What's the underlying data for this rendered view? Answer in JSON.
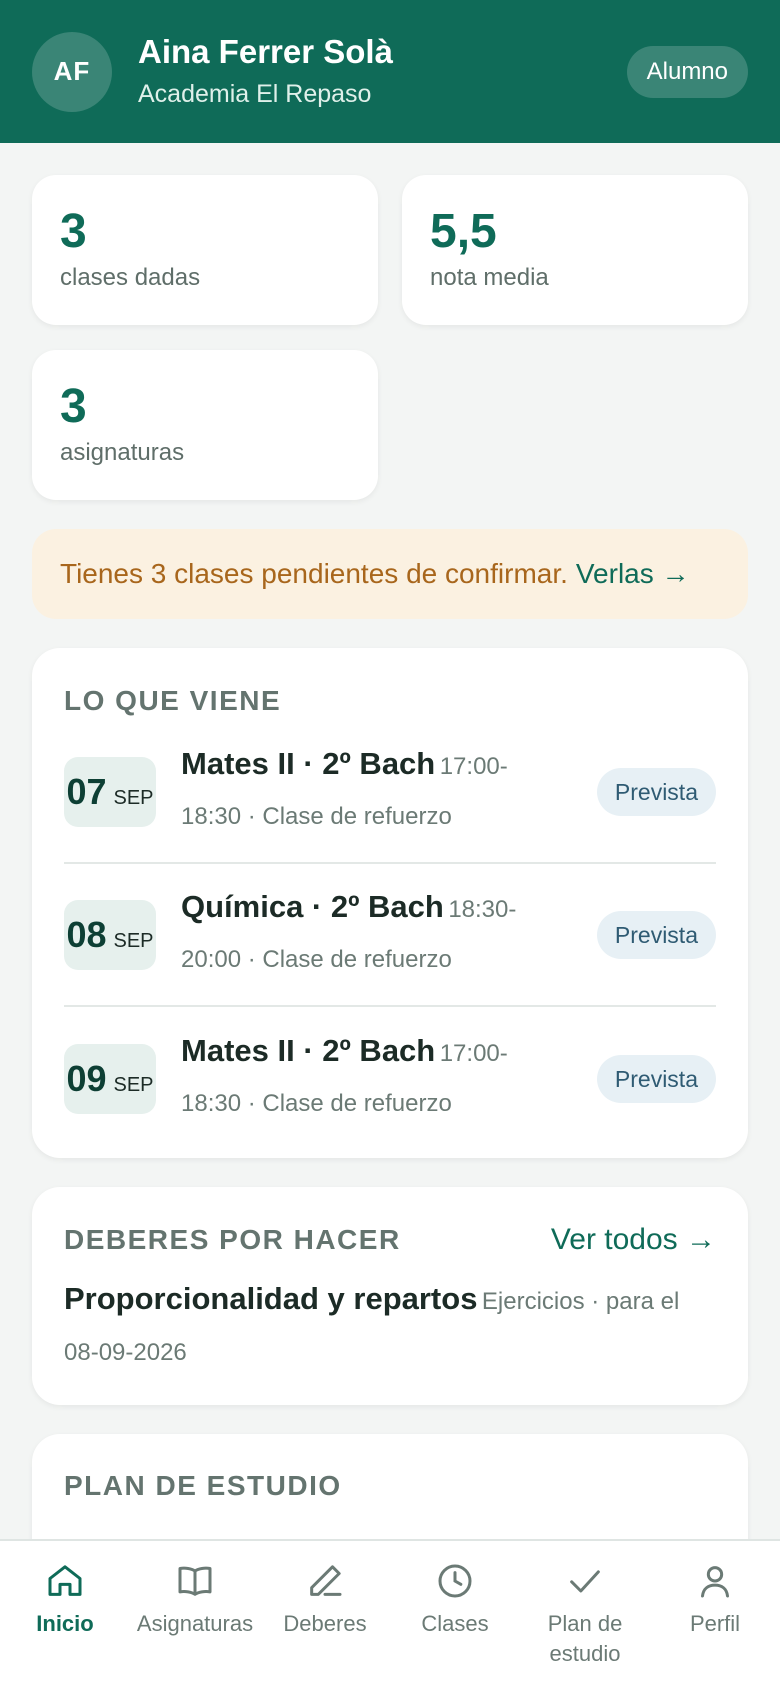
{
  "header": {
    "initials": "AF",
    "name": "Aina Ferrer Solà",
    "school": "Academia El Repaso",
    "role": "Alumno"
  },
  "stats": [
    {
      "value": "3",
      "label": "clases dadas"
    },
    {
      "value": "5,5",
      "label": "nota media"
    },
    {
      "value": "3",
      "label": "asignaturas"
    }
  ],
  "alert": {
    "text": "Tienes 3 clases pendientes de confirmar.",
    "link": "Verlas →"
  },
  "upcoming": {
    "title": "LO QUE VIENE",
    "events": [
      {
        "day": "07",
        "month": "SEP",
        "title": "Mates II · 2º Bach",
        "time": "17:00-",
        "meta": "18:30 · Clase de refuerzo",
        "status": "Prevista"
      },
      {
        "day": "08",
        "month": "SEP",
        "title": "Química · 2º Bach",
        "time": "18:30-",
        "meta": "20:00 · Clase de refuerzo",
        "status": "Prevista"
      },
      {
        "day": "09",
        "month": "SEP",
        "title": "Mates II · 2º Bach",
        "time": "17:00-",
        "meta": "18:30 · Clase de refuerzo",
        "status": "Prevista"
      }
    ]
  },
  "homework": {
    "title": "DEBERES POR HACER",
    "link": "Ver todos →",
    "item_title": "Proporcionalidad y repartos",
    "item_meta_1": "Ejercicios · para el",
    "item_meta_2": "08-09-2026"
  },
  "plan": {
    "title": "PLAN DE ESTUDIO"
  },
  "nav": [
    {
      "label": "Inicio",
      "icon": "home-icon",
      "active": true
    },
    {
      "label": "Asignaturas",
      "icon": "book-icon",
      "active": false
    },
    {
      "label": "Deberes",
      "icon": "pencil-icon",
      "active": false
    },
    {
      "label": "Clases",
      "icon": "clock-icon",
      "active": false
    },
    {
      "label": "Plan de estudio",
      "icon": "check-icon",
      "active": false
    },
    {
      "label": "Perfil",
      "icon": "user-icon",
      "active": false
    }
  ],
  "colors": {
    "brand": "#0f6b58",
    "alert_bg": "#fbf1e1",
    "alert_text": "#a8661c",
    "pill_bg": "#e7f0f5"
  }
}
